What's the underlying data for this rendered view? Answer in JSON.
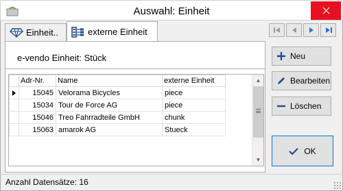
{
  "window": {
    "title": "Auswahl: Einheit"
  },
  "tabs": [
    {
      "label": "Einheit.."
    },
    {
      "label": "externe Einheit"
    }
  ],
  "evendo": {
    "label": "e-vendo Einheit:",
    "value": "Stück"
  },
  "grid": {
    "columns": [
      "Adr-Nr.",
      "Name",
      "externe Einheit"
    ],
    "rows": [
      {
        "adr": "15045",
        "name": "Velorama Bicycles",
        "ext": "piece"
      },
      {
        "adr": "15034",
        "name": "Tour de Force AG",
        "ext": "piece"
      },
      {
        "adr": "15046",
        "name": "Treo Fahrradteile GmbH",
        "ext": "chunk"
      },
      {
        "adr": "15063",
        "name": "amarok AG",
        "ext": "Stueck"
      }
    ]
  },
  "buttons": {
    "neu": "Neu",
    "bearbeiten": "Bearbeiten",
    "loeschen": "Löschen",
    "ok": "OK"
  },
  "status": {
    "text": "Anzahl Datensätze: 16"
  },
  "colors": {
    "accent": "#0078d7",
    "close": "#e81123",
    "nav_blue": "#2a6fd6"
  }
}
